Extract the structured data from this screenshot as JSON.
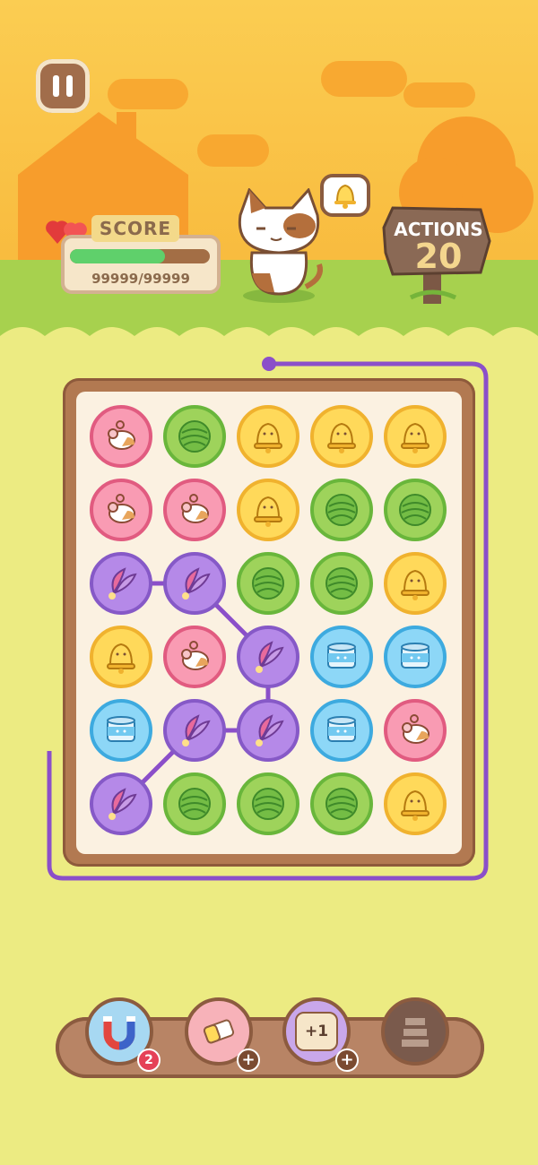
{
  "score": {
    "label": "SCORE",
    "value_text": "99999/99999",
    "progress": 0.68
  },
  "actions": {
    "label": "ACTIONS",
    "count": "20"
  },
  "target_item": "bell",
  "board": {
    "grid": [
      [
        "mouse",
        "yarn",
        "bell",
        "bell",
        "bell"
      ],
      [
        "mouse",
        "mouse",
        "bell",
        "yarn",
        "yarn"
      ],
      [
        "feather",
        "feather",
        "yarn",
        "yarn",
        "bell"
      ],
      [
        "bell",
        "mouse",
        "feather",
        "can",
        "can"
      ],
      [
        "can",
        "feather",
        "feather",
        "can",
        "mouse"
      ],
      [
        "feather",
        "yarn",
        "yarn",
        "yarn",
        "bell"
      ]
    ],
    "selected_chain": [
      [
        2,
        0
      ],
      [
        2,
        1
      ],
      [
        3,
        2
      ],
      [
        4,
        2
      ],
      [
        4,
        1
      ],
      [
        5,
        0
      ]
    ]
  },
  "powerups": [
    {
      "name": "magnet",
      "badge": "2"
    },
    {
      "name": "eraser",
      "badge": "+"
    },
    {
      "name": "plus-one",
      "text": "+1",
      "badge": "+"
    },
    {
      "name": "shelf",
      "locked": true
    }
  ],
  "colors": {
    "chain": "#8b4fc9",
    "mouse": "#f99bb3",
    "yarn": "#9ed35b",
    "bell": "#ffd95a",
    "feather": "#b589e8",
    "can": "#8dd7f7"
  }
}
